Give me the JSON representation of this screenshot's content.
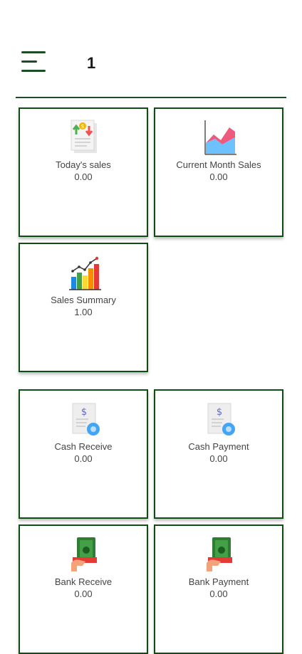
{
  "header": {
    "title": "1",
    "menu_icon": "hamburger-menu-icon"
  },
  "cards": [
    {
      "label": "Today's sales",
      "value": "0.00",
      "icon": "sales-receipt-icon"
    },
    {
      "label": "Current Month Sales",
      "value": "0.00",
      "icon": "area-chart-icon"
    },
    {
      "label": "Sales Summary",
      "value": "1.00",
      "icon": "bar-chart-icon"
    },
    {
      "label": "Cash Receive",
      "value": "0.00",
      "icon": "cash-document-icon"
    },
    {
      "label": "Cash Payment",
      "value": "0.00",
      "icon": "cash-document-icon"
    },
    {
      "label": "Bank Receive",
      "value": "0.00",
      "icon": "money-hand-icon"
    },
    {
      "label": "Bank Payment",
      "value": "0.00",
      "icon": "money-hand-icon"
    }
  ],
  "colors": {
    "accent": "#0f4d12",
    "text": "#444444"
  }
}
